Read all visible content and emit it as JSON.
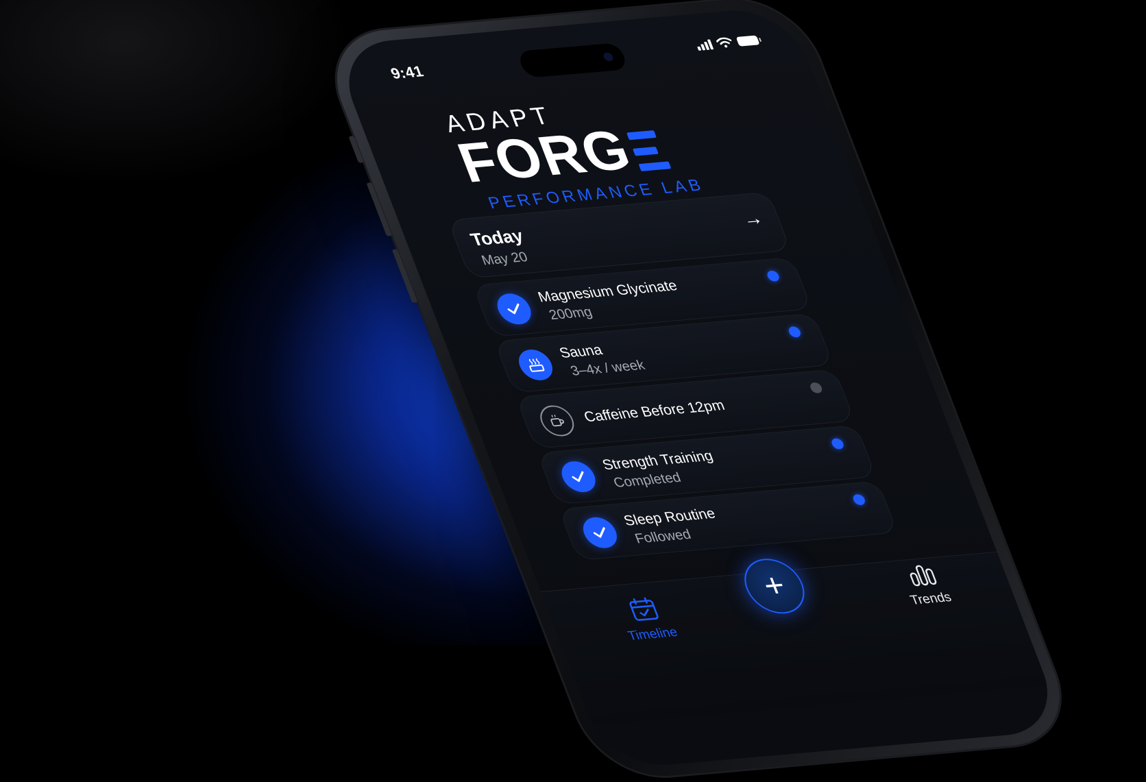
{
  "status_bar": {
    "time": "9:41"
  },
  "logo": {
    "line1": "ADAPT",
    "line2": "FORG",
    "line3": "PERFORMANCE LAB"
  },
  "today": {
    "title": "Today",
    "date": "May 20"
  },
  "items": [
    {
      "title": "Magnesium Glycinate",
      "subtitle": "200mg",
      "icon": "check-icon",
      "status": "done"
    },
    {
      "title": "Sauna",
      "subtitle": "3–4x / week",
      "icon": "sauna-icon",
      "status": "active"
    },
    {
      "title": "Caffeine Before 12pm",
      "subtitle": "",
      "icon": "coffee-cup-icon",
      "status": "pending"
    },
    {
      "title": "Strength Training",
      "subtitle": "Completed",
      "icon": "check-icon",
      "status": "done"
    },
    {
      "title": "Sleep Routine",
      "subtitle": "Followed",
      "icon": "check-icon",
      "status": "done"
    }
  ],
  "tabbar": {
    "timeline_label": "Timeline",
    "trends_label": "Trends"
  },
  "colors": {
    "accent": "#1f5cff",
    "background": "#0b0d12",
    "muted": "#a5a9b3"
  }
}
